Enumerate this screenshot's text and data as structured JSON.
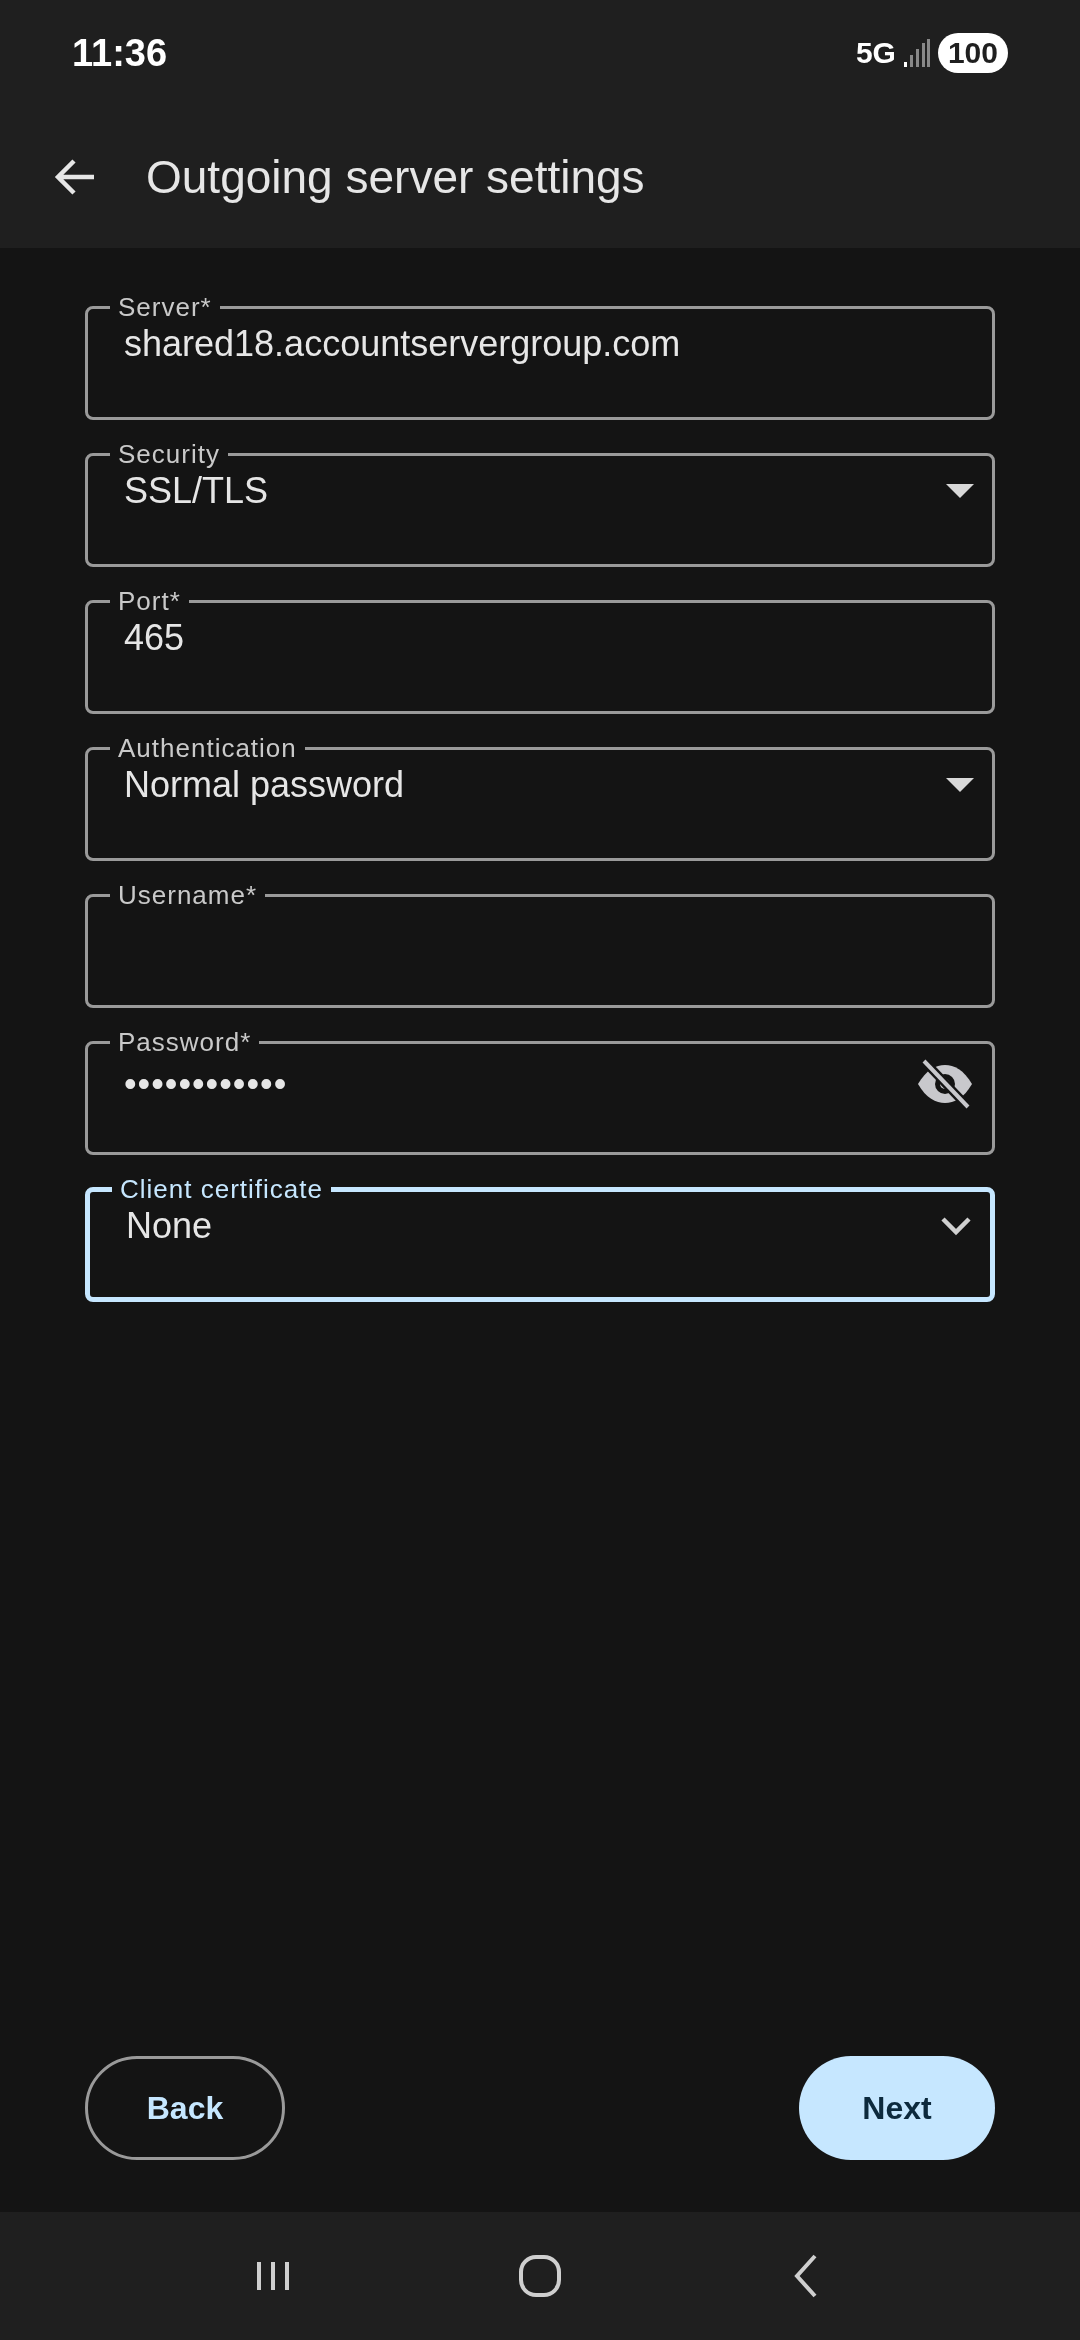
{
  "status_bar": {
    "time": "11:36",
    "network": "5G",
    "battery": "100"
  },
  "app_bar": {
    "title": "Outgoing server settings"
  },
  "fields": [
    {
      "kind": "text",
      "label": "Server*",
      "value": "shared18.accountservergroup.com",
      "focused": false
    },
    {
      "kind": "dropdown",
      "label": "Security",
      "value": "SSL/TLS",
      "focused": false
    },
    {
      "kind": "text",
      "label": "Port*",
      "value": "465",
      "focused": false
    },
    {
      "kind": "dropdown",
      "label": "Authentication",
      "value": "Normal password",
      "focused": false
    },
    {
      "kind": "text",
      "label": "Username*",
      "focused": false
    },
    {
      "kind": "password",
      "label": "Password*",
      "value": "••••••••••••",
      "focused": false
    },
    {
      "kind": "select",
      "label": "Client certificate",
      "value": "None",
      "focused": true
    }
  ],
  "buttons": [
    {
      "label": "Back",
      "kind": "outlined"
    },
    {
      "label": "Next",
      "kind": "filled"
    }
  ]
}
